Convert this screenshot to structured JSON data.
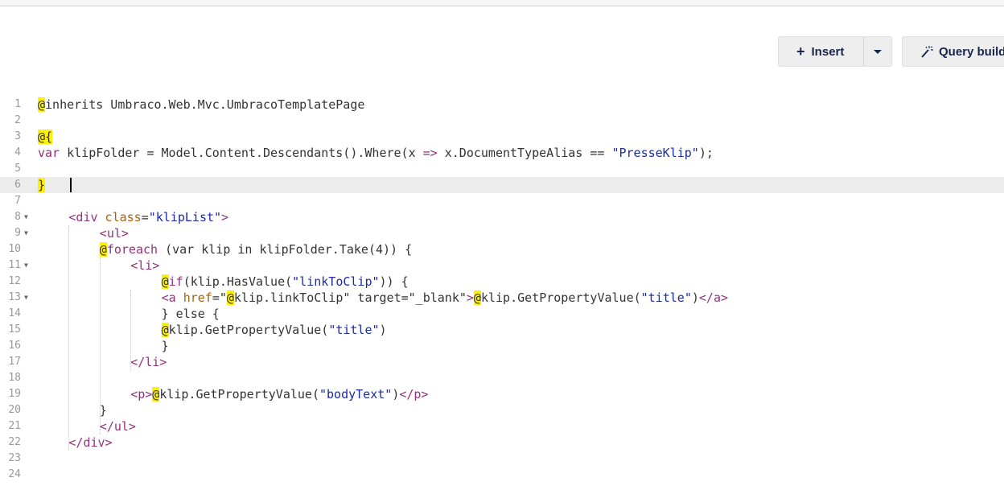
{
  "toolbar": {
    "insert_label": "Insert",
    "query_label": "Query build"
  },
  "icons": {
    "insert": "plus-icon",
    "dropdown": "chevron-down-icon",
    "query": "magic-wand-icon"
  },
  "colors": {
    "at_highlight": "#fff000",
    "tag": "#93317d",
    "attribute": "#a5620e",
    "string": "#1a2ba6",
    "button_text": "#1b264f"
  },
  "editor": {
    "active_line": 6,
    "lines": [
      {
        "n": "1",
        "fold": false,
        "indent": 0,
        "tokens": [
          [
            "at",
            "@"
          ],
          [
            "p",
            "inherits Umbraco.Web.Mvc.UmbracoTemplatePage"
          ]
        ]
      },
      {
        "n": "2",
        "fold": false,
        "indent": 0,
        "tokens": []
      },
      {
        "n": "3",
        "fold": false,
        "indent": 0,
        "tokens": [
          [
            "at",
            "@{"
          ]
        ]
      },
      {
        "n": "4",
        "fold": false,
        "indent": 0,
        "tokens": [
          [
            "kw",
            "var"
          ],
          [
            "p",
            " klipFolder = Model.Content.Descendants().Where(x "
          ],
          [
            "kw",
            "=>"
          ],
          [
            "p",
            " x.DocumentTypeAlias == "
          ],
          [
            "str",
            "\"PresseKlip\""
          ],
          [
            "p",
            ");"
          ]
        ]
      },
      {
        "n": "5",
        "fold": false,
        "indent": 0,
        "tokens": []
      },
      {
        "n": "6",
        "fold": false,
        "indent": 0,
        "tokens": [
          [
            "at",
            "}"
          ]
        ]
      },
      {
        "n": "7",
        "fold": false,
        "indent": 0,
        "tokens": []
      },
      {
        "n": "8",
        "fold": true,
        "indent": 4,
        "tokens": [
          [
            "tag",
            "<div"
          ],
          [
            "p",
            " "
          ],
          [
            "attr",
            "class"
          ],
          [
            "p",
            "="
          ],
          [
            "str",
            "\"klipList\""
          ],
          [
            "tag",
            ">"
          ]
        ]
      },
      {
        "n": "9",
        "fold": true,
        "indent": 8,
        "tokens": [
          [
            "tag",
            "<ul>"
          ]
        ]
      },
      {
        "n": "10",
        "fold": false,
        "indent": 8,
        "tokens": [
          [
            "at",
            "@"
          ],
          [
            "kw",
            "foreach"
          ],
          [
            "p",
            " (var klip in klipFolder.Take(4)) {"
          ]
        ]
      },
      {
        "n": "11",
        "fold": true,
        "indent": 12,
        "tokens": [
          [
            "tag",
            "<li>"
          ]
        ]
      },
      {
        "n": "12",
        "fold": false,
        "indent": 16,
        "tokens": [
          [
            "at",
            "@"
          ],
          [
            "kw",
            "if"
          ],
          [
            "p",
            "(klip.HasValue("
          ],
          [
            "str",
            "\"linkToClip\""
          ],
          [
            "p",
            ")) {"
          ]
        ]
      },
      {
        "n": "13",
        "fold": true,
        "indent": 16,
        "tokens": [
          [
            "tag",
            "<a"
          ],
          [
            "p",
            " "
          ],
          [
            "attr",
            "href"
          ],
          [
            "p",
            "=\""
          ],
          [
            "at",
            "@"
          ],
          [
            "p",
            "klip.linkToClip\" target=\"_blank\""
          ],
          [
            "tag",
            ">"
          ],
          [
            "at",
            "@"
          ],
          [
            "p",
            "klip.GetPropertyValue("
          ],
          [
            "str",
            "\"title\""
          ],
          [
            "p",
            ")"
          ],
          [
            "tag",
            "</a>"
          ]
        ]
      },
      {
        "n": "14",
        "fold": false,
        "indent": 16,
        "tokens": [
          [
            "p",
            "} else {"
          ]
        ]
      },
      {
        "n": "15",
        "fold": false,
        "indent": 16,
        "tokens": [
          [
            "at",
            "@"
          ],
          [
            "p",
            "klip.GetPropertyValue("
          ],
          [
            "str",
            "\"title\""
          ],
          [
            "p",
            ")"
          ]
        ]
      },
      {
        "n": "16",
        "fold": false,
        "indent": 16,
        "tokens": [
          [
            "p",
            "}"
          ]
        ]
      },
      {
        "n": "17",
        "fold": false,
        "indent": 12,
        "tokens": [
          [
            "tag",
            "</li>"
          ]
        ]
      },
      {
        "n": "18",
        "fold": false,
        "indent": 0,
        "tokens": []
      },
      {
        "n": "19",
        "fold": false,
        "indent": 12,
        "tokens": [
          [
            "tag",
            "<p>"
          ],
          [
            "at",
            "@"
          ],
          [
            "p",
            "klip.GetPropertyValue("
          ],
          [
            "str",
            "\"bodyText\""
          ],
          [
            "p",
            ")"
          ],
          [
            "tag",
            "</p>"
          ]
        ]
      },
      {
        "n": "20",
        "fold": false,
        "indent": 8,
        "tokens": [
          [
            "p",
            "}"
          ]
        ]
      },
      {
        "n": "21",
        "fold": false,
        "indent": 8,
        "tokens": [
          [
            "tag",
            "</ul>"
          ]
        ]
      },
      {
        "n": "22",
        "fold": false,
        "indent": 4,
        "tokens": [
          [
            "tag",
            "</div>"
          ]
        ]
      },
      {
        "n": "23",
        "fold": false,
        "indent": 0,
        "tokens": []
      },
      {
        "n": "24",
        "fold": false,
        "indent": 0,
        "tokens": []
      }
    ]
  }
}
